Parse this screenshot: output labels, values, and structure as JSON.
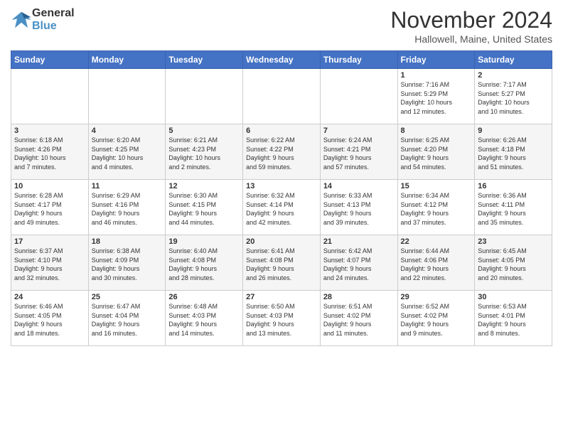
{
  "header": {
    "logo_general": "General",
    "logo_blue": "Blue",
    "title": "November 2024",
    "location": "Hallowell, Maine, United States"
  },
  "weekdays": [
    "Sunday",
    "Monday",
    "Tuesday",
    "Wednesday",
    "Thursday",
    "Friday",
    "Saturday"
  ],
  "weeks": [
    [
      {
        "day": "",
        "info": ""
      },
      {
        "day": "",
        "info": ""
      },
      {
        "day": "",
        "info": ""
      },
      {
        "day": "",
        "info": ""
      },
      {
        "day": "",
        "info": ""
      },
      {
        "day": "1",
        "info": "Sunrise: 7:16 AM\nSunset: 5:29 PM\nDaylight: 10 hours\nand 12 minutes."
      },
      {
        "day": "2",
        "info": "Sunrise: 7:17 AM\nSunset: 5:27 PM\nDaylight: 10 hours\nand 10 minutes."
      }
    ],
    [
      {
        "day": "3",
        "info": "Sunrise: 6:18 AM\nSunset: 4:26 PM\nDaylight: 10 hours\nand 7 minutes."
      },
      {
        "day": "4",
        "info": "Sunrise: 6:20 AM\nSunset: 4:25 PM\nDaylight: 10 hours\nand 4 minutes."
      },
      {
        "day": "5",
        "info": "Sunrise: 6:21 AM\nSunset: 4:23 PM\nDaylight: 10 hours\nand 2 minutes."
      },
      {
        "day": "6",
        "info": "Sunrise: 6:22 AM\nSunset: 4:22 PM\nDaylight: 9 hours\nand 59 minutes."
      },
      {
        "day": "7",
        "info": "Sunrise: 6:24 AM\nSunset: 4:21 PM\nDaylight: 9 hours\nand 57 minutes."
      },
      {
        "day": "8",
        "info": "Sunrise: 6:25 AM\nSunset: 4:20 PM\nDaylight: 9 hours\nand 54 minutes."
      },
      {
        "day": "9",
        "info": "Sunrise: 6:26 AM\nSunset: 4:18 PM\nDaylight: 9 hours\nand 51 minutes."
      }
    ],
    [
      {
        "day": "10",
        "info": "Sunrise: 6:28 AM\nSunset: 4:17 PM\nDaylight: 9 hours\nand 49 minutes."
      },
      {
        "day": "11",
        "info": "Sunrise: 6:29 AM\nSunset: 4:16 PM\nDaylight: 9 hours\nand 46 minutes."
      },
      {
        "day": "12",
        "info": "Sunrise: 6:30 AM\nSunset: 4:15 PM\nDaylight: 9 hours\nand 44 minutes."
      },
      {
        "day": "13",
        "info": "Sunrise: 6:32 AM\nSunset: 4:14 PM\nDaylight: 9 hours\nand 42 minutes."
      },
      {
        "day": "14",
        "info": "Sunrise: 6:33 AM\nSunset: 4:13 PM\nDaylight: 9 hours\nand 39 minutes."
      },
      {
        "day": "15",
        "info": "Sunrise: 6:34 AM\nSunset: 4:12 PM\nDaylight: 9 hours\nand 37 minutes."
      },
      {
        "day": "16",
        "info": "Sunrise: 6:36 AM\nSunset: 4:11 PM\nDaylight: 9 hours\nand 35 minutes."
      }
    ],
    [
      {
        "day": "17",
        "info": "Sunrise: 6:37 AM\nSunset: 4:10 PM\nDaylight: 9 hours\nand 32 minutes."
      },
      {
        "day": "18",
        "info": "Sunrise: 6:38 AM\nSunset: 4:09 PM\nDaylight: 9 hours\nand 30 minutes."
      },
      {
        "day": "19",
        "info": "Sunrise: 6:40 AM\nSunset: 4:08 PM\nDaylight: 9 hours\nand 28 minutes."
      },
      {
        "day": "20",
        "info": "Sunrise: 6:41 AM\nSunset: 4:08 PM\nDaylight: 9 hours\nand 26 minutes."
      },
      {
        "day": "21",
        "info": "Sunrise: 6:42 AM\nSunset: 4:07 PM\nDaylight: 9 hours\nand 24 minutes."
      },
      {
        "day": "22",
        "info": "Sunrise: 6:44 AM\nSunset: 4:06 PM\nDaylight: 9 hours\nand 22 minutes."
      },
      {
        "day": "23",
        "info": "Sunrise: 6:45 AM\nSunset: 4:05 PM\nDaylight: 9 hours\nand 20 minutes."
      }
    ],
    [
      {
        "day": "24",
        "info": "Sunrise: 6:46 AM\nSunset: 4:05 PM\nDaylight: 9 hours\nand 18 minutes."
      },
      {
        "day": "25",
        "info": "Sunrise: 6:47 AM\nSunset: 4:04 PM\nDaylight: 9 hours\nand 16 minutes."
      },
      {
        "day": "26",
        "info": "Sunrise: 6:48 AM\nSunset: 4:03 PM\nDaylight: 9 hours\nand 14 minutes."
      },
      {
        "day": "27",
        "info": "Sunrise: 6:50 AM\nSunset: 4:03 PM\nDaylight: 9 hours\nand 13 minutes."
      },
      {
        "day": "28",
        "info": "Sunrise: 6:51 AM\nSunset: 4:02 PM\nDaylight: 9 hours\nand 11 minutes."
      },
      {
        "day": "29",
        "info": "Sunrise: 6:52 AM\nSunset: 4:02 PM\nDaylight: 9 hours\nand 9 minutes."
      },
      {
        "day": "30",
        "info": "Sunrise: 6:53 AM\nSunset: 4:01 PM\nDaylight: 9 hours\nand 8 minutes."
      }
    ]
  ]
}
